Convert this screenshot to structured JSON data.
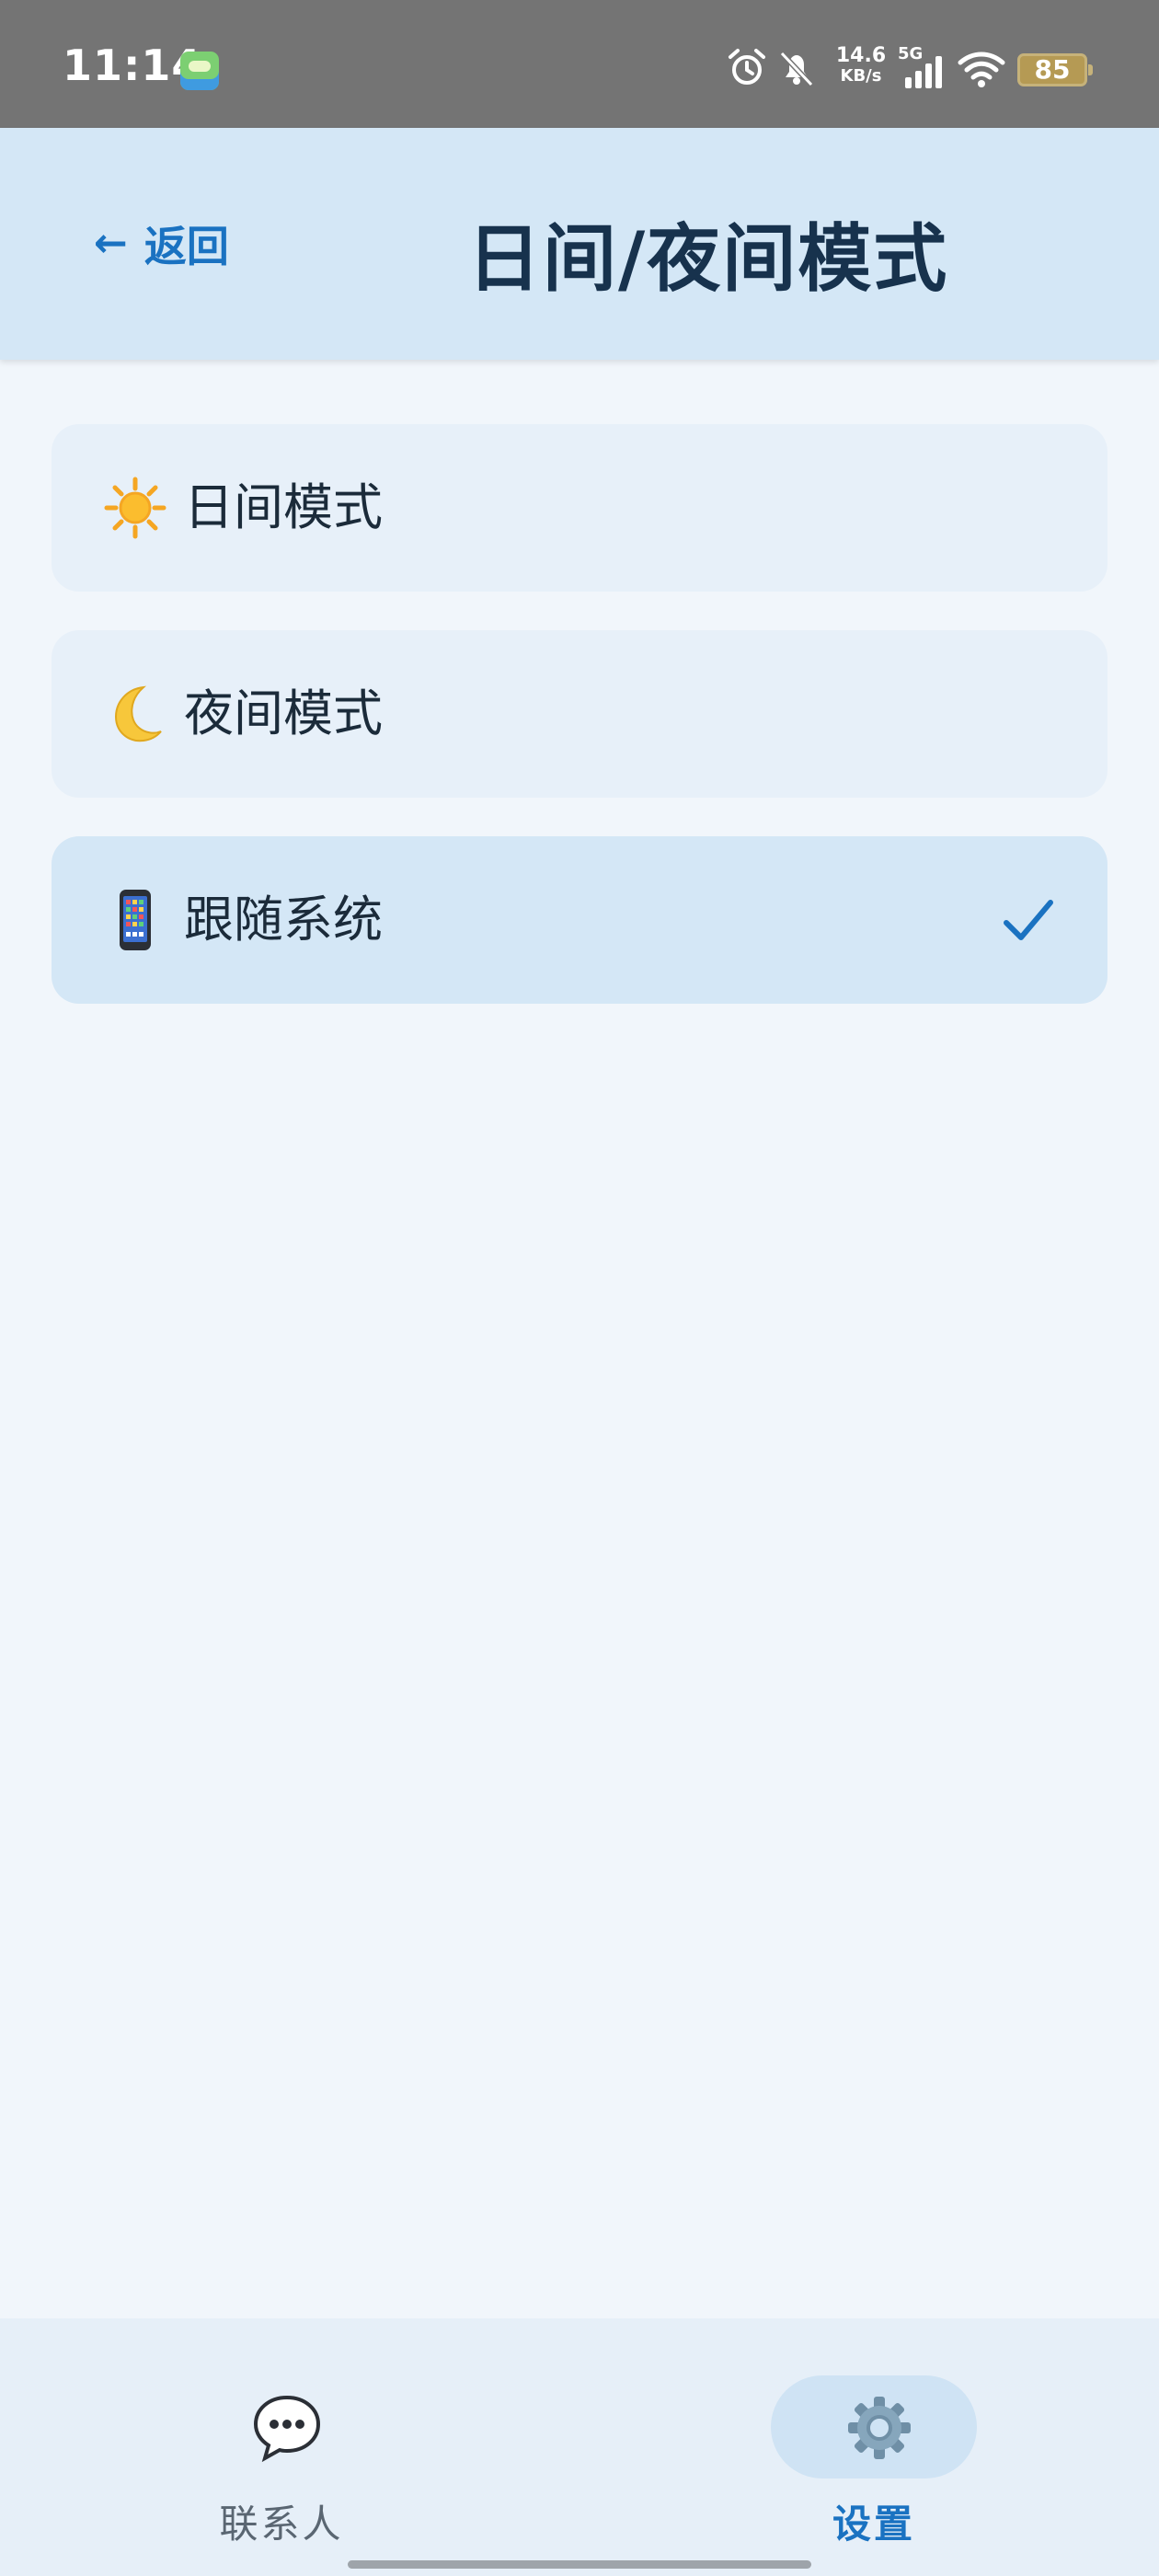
{
  "status_bar": {
    "time": "11:14",
    "net_speed_value": "14.6",
    "net_speed_unit": "KB/s",
    "net_type": "5G",
    "battery": "85",
    "icons": [
      "app-icon",
      "alarm-icon",
      "bell-off-icon",
      "signal-icon",
      "wifi-icon",
      "battery-icon"
    ]
  },
  "header": {
    "back_arrow": "←",
    "back_label": "返回",
    "title": "日间/夜间模式"
  },
  "options": [
    {
      "icon": "sun-icon",
      "label": "日间模式",
      "selected": false
    },
    {
      "icon": "moon-icon",
      "label": "夜间模式",
      "selected": false
    },
    {
      "icon": "phone-icon",
      "label": "跟随系统",
      "selected": true
    }
  ],
  "bottom_nav": {
    "items": [
      {
        "icon": "chat-bubble-icon",
        "label": "联系人",
        "active": false
      },
      {
        "icon": "gear-icon",
        "label": "设置",
        "active": true
      }
    ]
  },
  "colors": {
    "accent": "#1a72c1",
    "header_bg": "#d4e7f6",
    "page_bg": "#f1f6fb",
    "card_bg": "#e7f0f9",
    "selected_card_bg": "#d4e7f6",
    "title_text": "#17324d"
  }
}
